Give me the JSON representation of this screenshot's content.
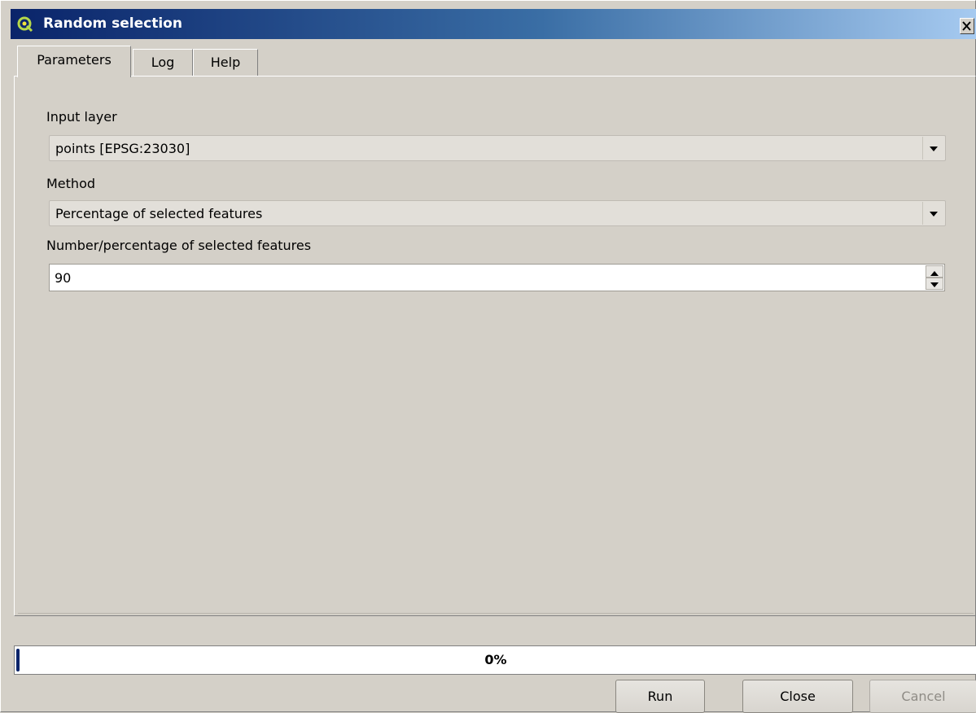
{
  "window": {
    "title": "Random selection",
    "close_label": "X"
  },
  "tabs": [
    {
      "label": "Parameters",
      "active": true
    },
    {
      "label": "Log",
      "active": false
    },
    {
      "label": "Help",
      "active": false
    }
  ],
  "form": {
    "input_layer": {
      "label": "Input layer",
      "value": "points [EPSG:23030]"
    },
    "method": {
      "label": "Method",
      "value": "Percentage of selected features"
    },
    "number": {
      "label": "Number/percentage of selected features",
      "value": "90"
    }
  },
  "progress": {
    "text": "0%",
    "percent": 0
  },
  "buttons": {
    "run": "Run",
    "close": "Close",
    "cancel": "Cancel"
  },
  "colors": {
    "titlebar_start": "#0a246a",
    "titlebar_end": "#a6caf0",
    "window_bg": "#d4d0c8",
    "progress_fill": "#0a246a"
  },
  "icons": {
    "app": "qgis-logo-icon",
    "close": "close-icon",
    "combo_arrow": "chevron-down-icon",
    "spin_up": "spin-up-icon",
    "spin_down": "spin-down-icon"
  }
}
